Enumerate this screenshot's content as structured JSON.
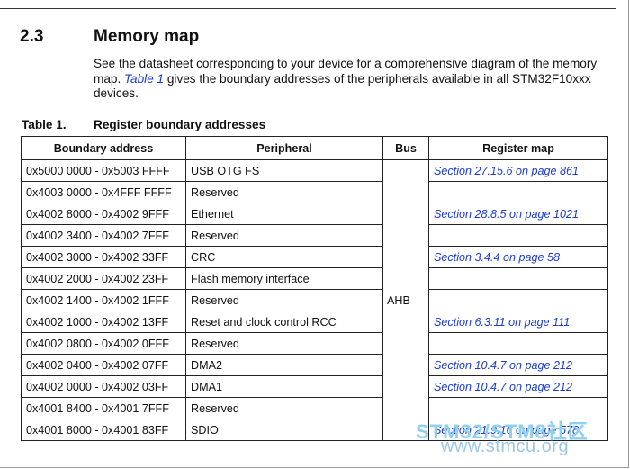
{
  "section": {
    "number": "2.3",
    "title": "Memory map"
  },
  "intro": {
    "before": "See the datasheet corresponding to your device for a comprehensive diagram of the memory map. ",
    "link": "Table 1",
    "after": " gives the boundary addresses of the peripherals available in all STM32F10xxx devices."
  },
  "table": {
    "caption_num": "Table 1.",
    "caption_title": "Register boundary addresses",
    "headers": [
      "Boundary address",
      "Peripheral",
      "Bus",
      "Register map"
    ],
    "bus": "AHB",
    "rows": [
      {
        "address": "0x5000 0000 - 0x5003 FFFF",
        "peripheral": "USB OTG FS",
        "regmap": "Section 27.15.6 on page 861"
      },
      {
        "address": "0x4003 0000 - 0x4FFF FFFF",
        "peripheral": "Reserved",
        "regmap": ""
      },
      {
        "address": "0x4002 8000 - 0x4002 9FFF",
        "peripheral": "Ethernet",
        "regmap": "Section 28.8.5 on page 1021"
      },
      {
        "address": "0x4002 3400 - 0x4002 7FFF",
        "peripheral": "Reserved",
        "regmap": ""
      },
      {
        "address": "0x4002 3000 - 0x4002 33FF",
        "peripheral": "CRC",
        "regmap": "Section 3.4.4 on page 58"
      },
      {
        "address": "0x4002 2000 - 0x4002 23FF",
        "peripheral": "Flash memory interface",
        "regmap": ""
      },
      {
        "address": "0x4002 1400 - 0x4002 1FFF",
        "peripheral": "Reserved",
        "regmap": ""
      },
      {
        "address": "0x4002 1000 - 0x4002 13FF",
        "peripheral": "Reset and clock control RCC",
        "regmap": "Section 6.3.11 on page 111"
      },
      {
        "address": "0x4002 0800 - 0x4002 0FFF",
        "peripheral": "Reserved",
        "regmap": ""
      },
      {
        "address": "0x4002 0400 - 0x4002 07FF",
        "peripheral": "DMA2",
        "regmap": "Section 10.4.7 on page 212"
      },
      {
        "address": "0x4002 0000 - 0x4002 03FF",
        "peripheral": "DMA1",
        "regmap": "Section 10.4.7 on page 212"
      },
      {
        "address": "0x4001 8400 - 0x4001 7FFF",
        "peripheral": "Reserved",
        "regmap": ""
      },
      {
        "address": "0x4001 8000 - 0x4001 83FF",
        "peripheral": "SDIO",
        "regmap": "Section 21.9.16 on page 578"
      }
    ]
  },
  "watermark": {
    "line1": "STM32/STM8社区",
    "line2": "www.stmcu.org"
  },
  "colors": {
    "link": "#1c3ad6",
    "watermark": "#8fd0ee"
  }
}
